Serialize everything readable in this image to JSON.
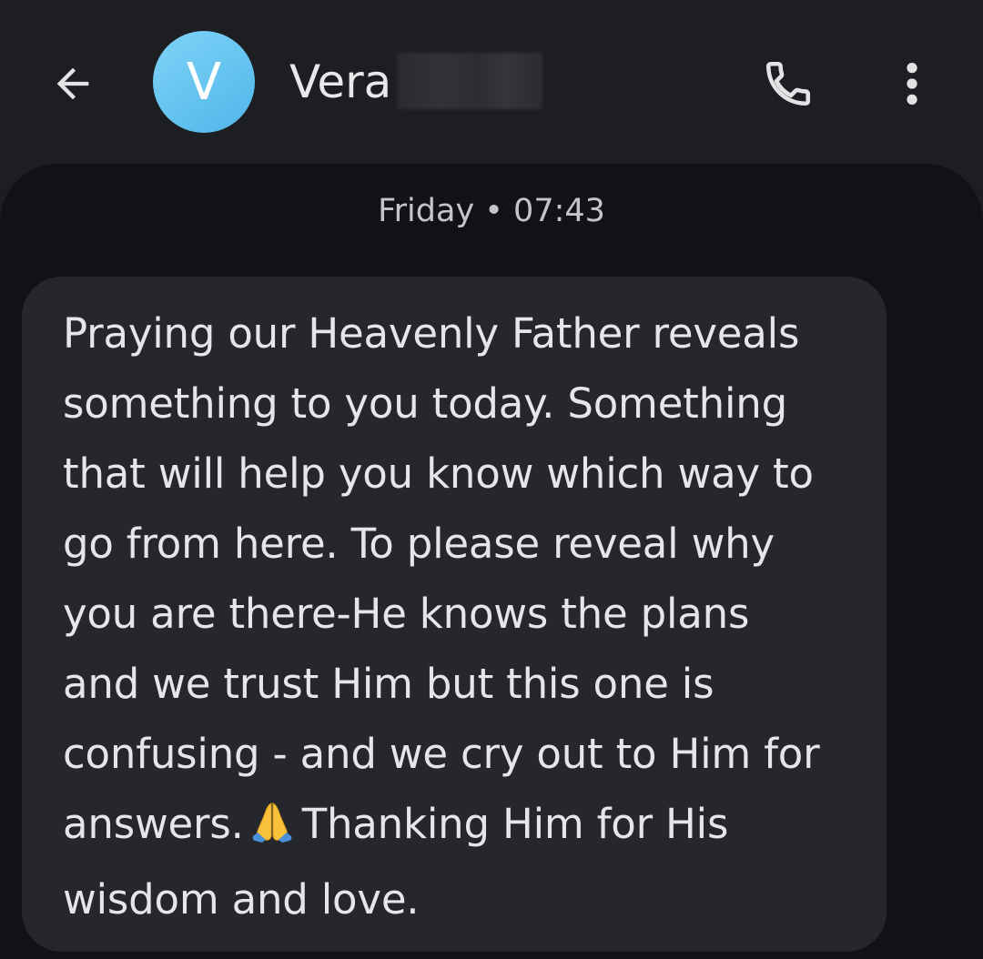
{
  "header": {
    "back_icon": "arrow-left-icon",
    "avatar_letter": "V",
    "contact_name": "Vera",
    "call_icon": "phone-icon",
    "more_icon": "more-vertical-icon"
  },
  "conversation": {
    "timestamp": "Friday • 07:43",
    "message": {
      "text_before_emoji": "Praying our Heavenly Father reveals\nsomething to you today. Something\nthat will help you know which way to\ngo from here. To please reveal why\nyou are there-He knows the plans\nand we trust Him but this one is\nconfusing - and we cry out to Him for\nanswers.",
      "emoji_icon": "folded-hands-icon",
      "text_after_emoji": "Thanking Him for His\nwisdom and love."
    }
  },
  "colors": {
    "background": "#1d1e22",
    "panel": "#111215",
    "bubble": "#26272c",
    "avatar": "#5bbcf0",
    "text": "#e6e6e9"
  }
}
